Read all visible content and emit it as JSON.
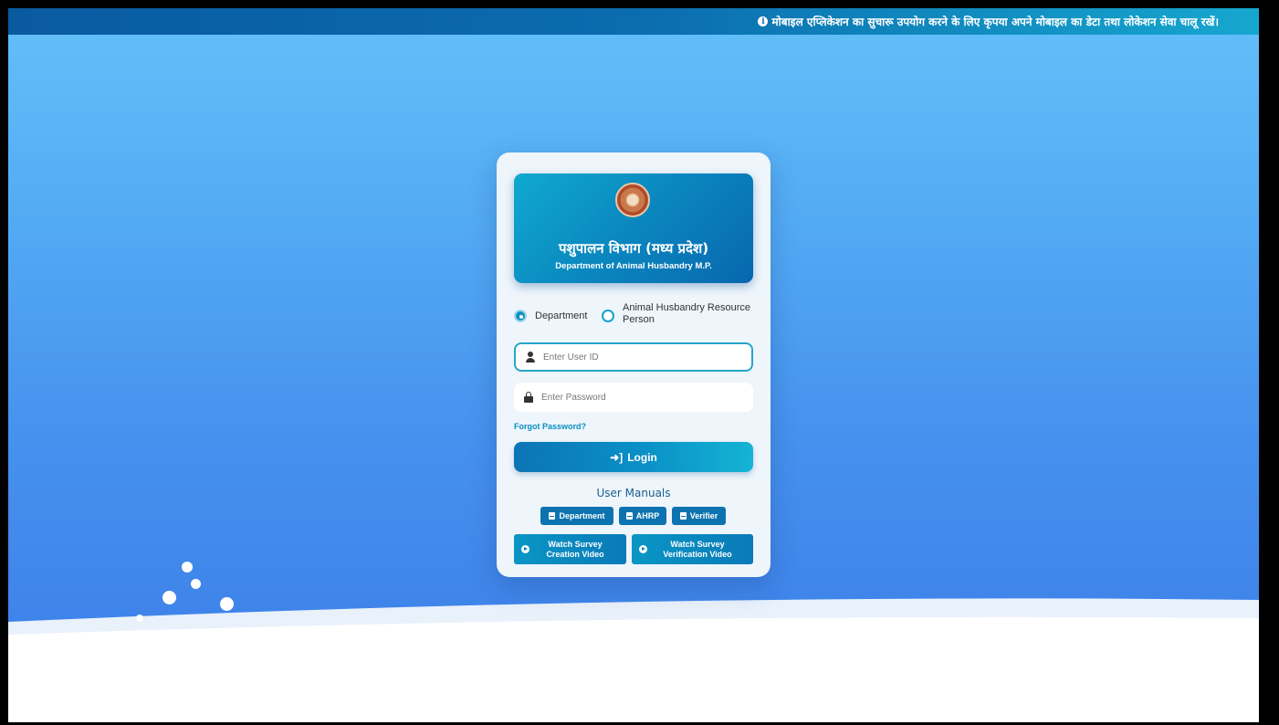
{
  "banner": {
    "icon": "info-circle-icon",
    "text": "मोबाइल एप्लिकेशन का सुचारू उपयोग करने के लिए कृपया अपने मोबाइल का डेटा तथा लोकेशन सेवा चालू रखें।"
  },
  "header": {
    "logo": "mp-government-emblem",
    "title_hindi": "पशुपालन विभाग (मध्य प्रदेश)",
    "title_english": "Department of Animal Husbandry M.P."
  },
  "login_type": {
    "options": [
      {
        "label": "Department",
        "checked": true
      },
      {
        "label": "Animal Husbandry Resource Person",
        "checked": false
      }
    ]
  },
  "form": {
    "user_id": {
      "placeholder": "Enter User ID",
      "value": "",
      "icon": "user-icon"
    },
    "password": {
      "placeholder": "Enter Password",
      "value": "",
      "icon": "lock-icon"
    },
    "forgot_label": "Forgot Password?",
    "login_label": "Login",
    "login_icon": "sign-in-icon"
  },
  "manuals": {
    "title": "User Manuals",
    "buttons": [
      {
        "label": "Department",
        "icon": "file-icon"
      },
      {
        "label": "AHRP",
        "icon": "file-icon"
      },
      {
        "label": "Verifier",
        "icon": "file-icon"
      }
    ],
    "videos": [
      {
        "line1": "Watch Survey",
        "line2": "Creation Video",
        "icon": "play-circle-icon"
      },
      {
        "line1": "Watch Survey",
        "line2": "Verification Video",
        "icon": "play-circle-icon"
      }
    ]
  },
  "colors": {
    "accent": "#0a8fc4",
    "background_top": "#62c0f8",
    "background_bottom": "#3f84ea"
  }
}
